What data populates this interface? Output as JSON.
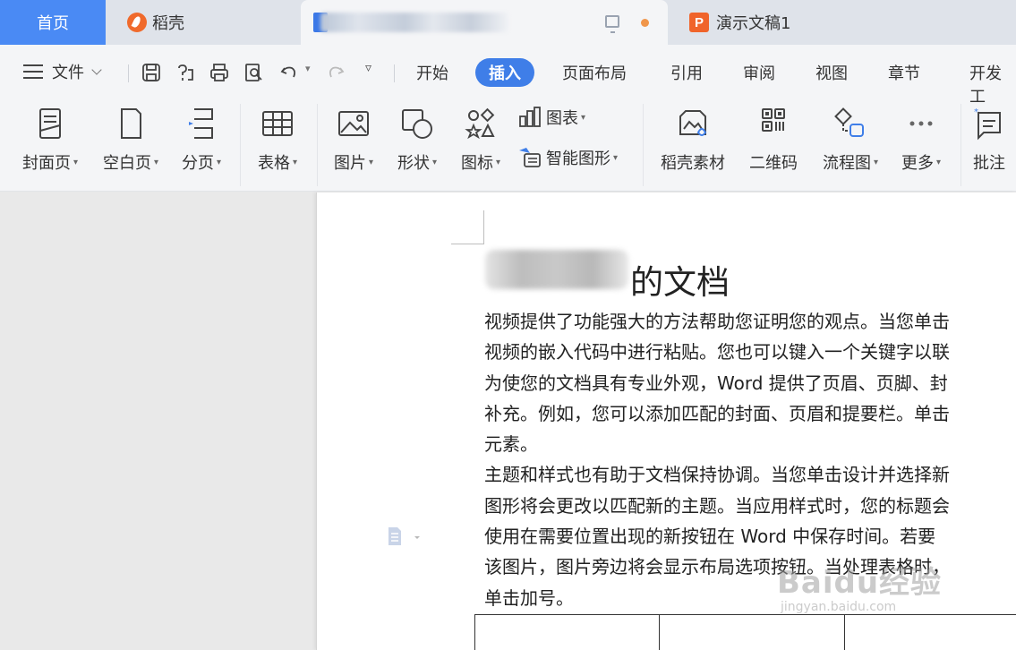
{
  "tabs": {
    "home": "首页",
    "daoke": "稻壳",
    "ppt": "演示文稿1"
  },
  "menu": {
    "file": "文件",
    "nav": [
      "开始",
      "插入",
      "页面布局",
      "引用",
      "审阅",
      "视图",
      "章节",
      "开发工"
    ],
    "active_nav": "插入"
  },
  "ribbon": {
    "cover": "封面页",
    "blank": "空白页",
    "pagebreak": "分页",
    "table": "表格",
    "picture": "图片",
    "shape": "形状",
    "icon": "图标",
    "chart": "图表",
    "smartart": "智能图形",
    "material": "稻壳素材",
    "qrcode": "二维码",
    "flowchart": "流程图",
    "more": "更多",
    "comment": "批注"
  },
  "document": {
    "title_suffix": "的文档",
    "lines": [
      "视频提供了功能强大的方法帮助您证明您的观点。当您单击",
      "视频的嵌入代码中进行粘贴。您也可以键入一个关键字以联",
      "为使您的文档具有专业外观，Word 提供了页眉、页脚、封",
      "补充。例如，您可以添加匹配的封面、页眉和提要栏。单击",
      "元素。",
      "主题和样式也有助于文档保持协调。当您单击设计并选择新",
      "图形将会更改以匹配新的主题。当应用样式时，您的标题会",
      "使用在需要位置出现的新按钮在 Word 中保存时间。若要",
      "该图片，图片旁边将会显示布局选项按钮。当处理表格时，",
      "单击加号。"
    ]
  },
  "watermark": {
    "brand": "Baidu经验",
    "url": "jingyan.baidu.com"
  },
  "colors": {
    "accent": "#3f7ee8",
    "home_tab": "#4a8af4",
    "daoke_logo": "#f06a2c",
    "ppt_icon": "#f0642b",
    "unsaved_dot": "#f0964a"
  }
}
